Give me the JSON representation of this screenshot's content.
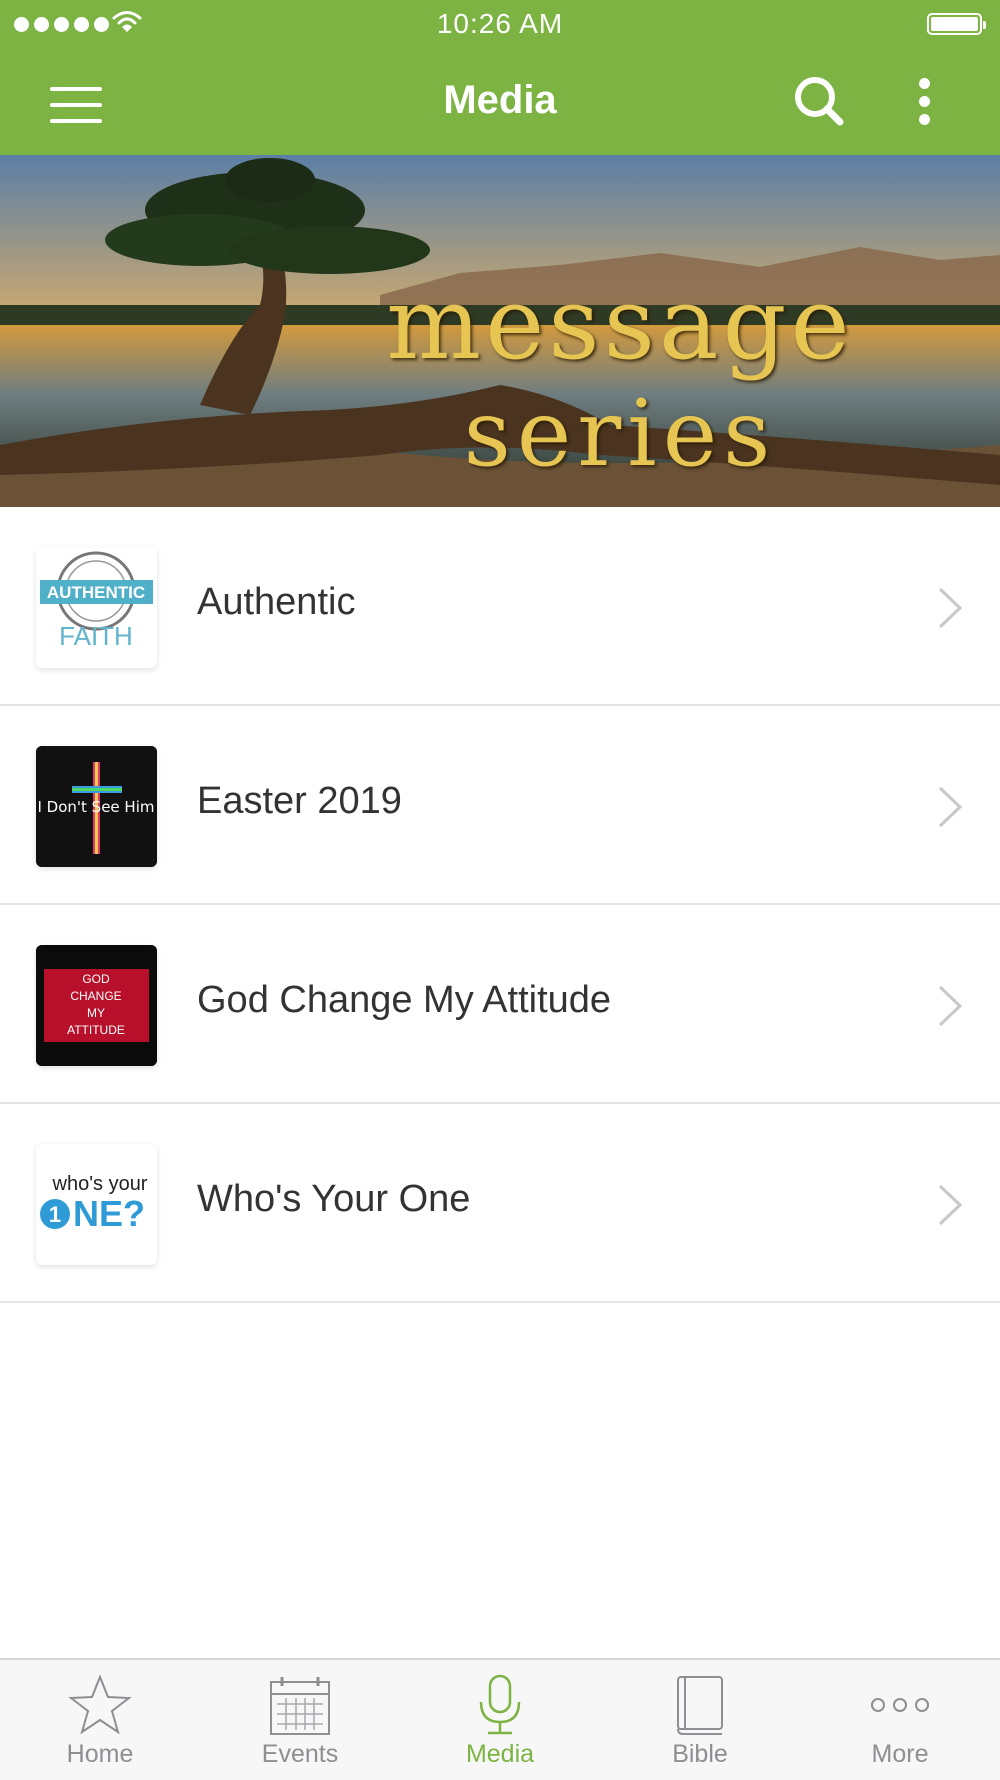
{
  "status_bar": {
    "time": "10:26 AM"
  },
  "nav": {
    "title": "Media"
  },
  "banner": {
    "line1": "message",
    "line2": "series"
  },
  "series": [
    {
      "label": "Authentic",
      "thumb": {
        "top": "100% AUTHENTIC REAL",
        "main": "AUTHENTIC",
        "bottom": "FAITH"
      }
    },
    {
      "label": "Easter 2019",
      "thumb": {
        "text": "I Don't See Him"
      }
    },
    {
      "label": "God Change My Attitude",
      "thumb": {
        "lines": [
          "GOD",
          "CHANGE",
          "MY",
          "ATTITUDE"
        ]
      }
    },
    {
      "label": "Who's Your One",
      "thumb": {
        "top": "who's your",
        "main": "ONE?",
        "digit": "1"
      }
    }
  ],
  "tabs": [
    {
      "label": "Home",
      "icon": "star-icon",
      "active": false
    },
    {
      "label": "Events",
      "icon": "calendar-icon",
      "active": false
    },
    {
      "label": "Media",
      "icon": "microphone-icon",
      "active": true
    },
    {
      "label": "Bible",
      "icon": "book-icon",
      "active": false
    },
    {
      "label": "More",
      "icon": "more-dots-icon",
      "active": false
    }
  ],
  "colors": {
    "accent": "#7cb342",
    "tab_inactive": "#8e8e93",
    "text": "#333333",
    "separator": "#e4e4e4"
  }
}
